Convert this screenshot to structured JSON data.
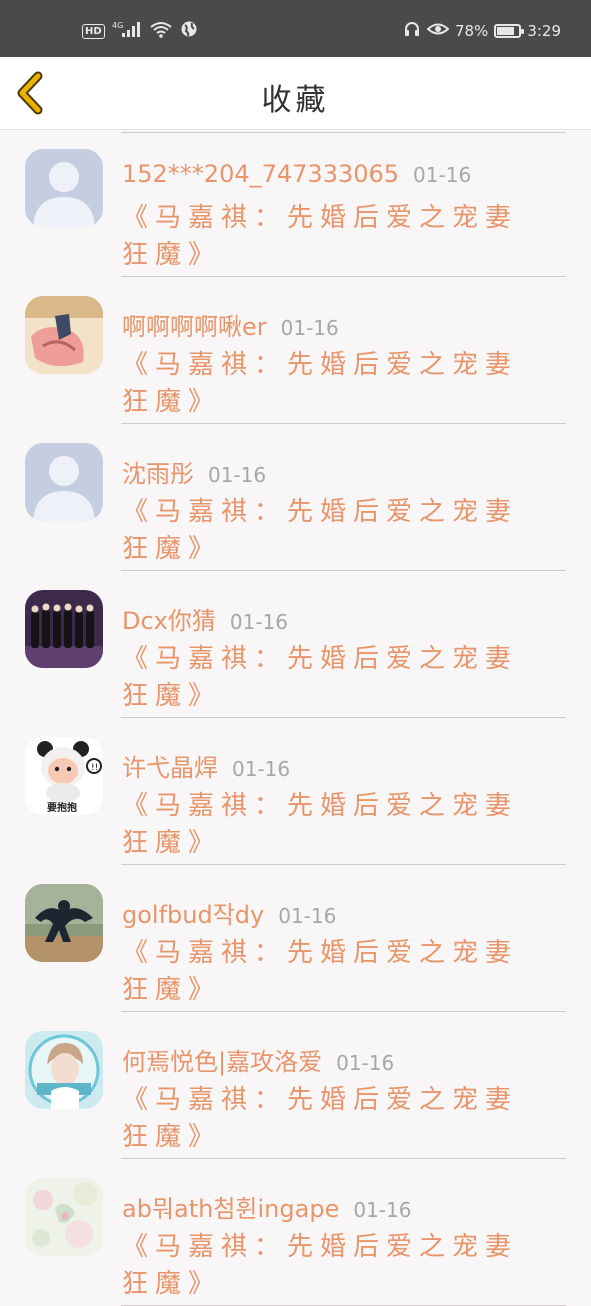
{
  "status_bar": {
    "network": "4G",
    "battery_level": 78,
    "battery_text": "78%",
    "time": "3:29"
  },
  "header": {
    "title": "收藏",
    "accent_color": "#e9b200"
  },
  "items": [
    {
      "username": "152***204_747333065",
      "date": "01-16",
      "title": "《马嘉祺：先婚后爱之宠妻狂魔》",
      "avatar": "default-person-avatar"
    },
    {
      "username": "啊啊啊啊啾er",
      "date": "01-16",
      "title": "《马嘉祺：先婚后爱之宠妻狂魔》",
      "avatar": "illustration-avatar"
    },
    {
      "username": "沈雨彤",
      "date": "01-16",
      "title": "《马嘉祺：先婚后爱之宠妻狂魔》",
      "avatar": "default-person-avatar"
    },
    {
      "username": "Dcx你猜",
      "date": "01-16",
      "title": "《马嘉祺：先婚后爱之宠妻狂魔》",
      "avatar": "group-photo-avatar"
    },
    {
      "username": "许弋晶焊",
      "date": "01-16",
      "title": "《马嘉祺：先婚后爱之宠妻狂魔》",
      "avatar": "panda-baby-avatar",
      "avatar_caption": "要抱抱"
    },
    {
      "username": "golfbud작dy",
      "date": "01-16",
      "title": "《马嘉祺：先婚后爱之宠妻狂魔》",
      "avatar": "dancer-photo-avatar"
    },
    {
      "username": "何焉悦色|嘉攻洛爱",
      "date": "01-16",
      "title": "《马嘉祺：先婚后爱之宠妻狂魔》",
      "avatar": "idol-photo-avatar"
    },
    {
      "username": "ab뭐ath첨휜ingape",
      "date": "01-16",
      "title": "《马嘉祺：先婚后爱之宠妻狂魔》",
      "avatar": "floral-avatar"
    }
  ]
}
